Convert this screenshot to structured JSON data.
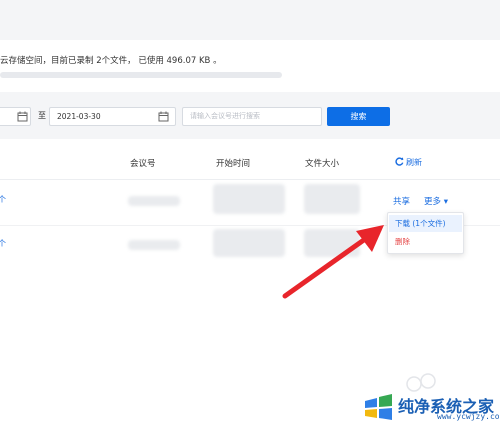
{
  "storage": {
    "text": "云存储空间，目前已录制 2个文件， 已使用 496.07 KB 。"
  },
  "filters": {
    "end_date": "2021-03-30",
    "to_label": "至",
    "search_placeholder": "请输入会议号进行搜索",
    "search_button": "搜索"
  },
  "table": {
    "headers": [
      "会议号",
      "开始时间",
      "文件大小"
    ],
    "refresh_label": "刷新",
    "row_link_fragment": "个",
    "actions": {
      "share": "共享",
      "more": "更多 ▾"
    }
  },
  "dropdown": {
    "download": "下载 (1个文件)",
    "delete": "删除"
  },
  "watermark": {
    "title": "纯净系统之家",
    "url": "www.ycwjzy.com"
  },
  "colors": {
    "accent": "#0d6ee6",
    "link": "#1b6de0",
    "danger": "#e54545",
    "arrow": "#e8252b"
  },
  "icons": [
    "calendar-icon",
    "refresh-icon",
    "pointer-arrow"
  ]
}
